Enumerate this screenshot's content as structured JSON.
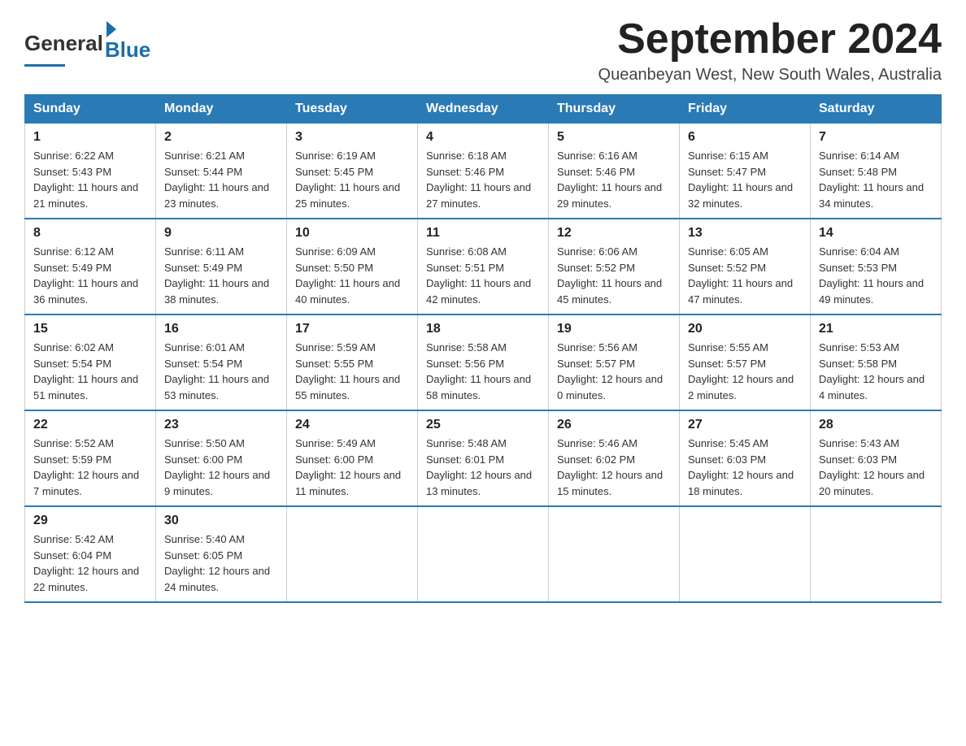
{
  "header": {
    "logo_general": "General",
    "logo_blue": "Blue",
    "month_title": "September 2024",
    "location": "Queanbeyan West, New South Wales, Australia"
  },
  "weekdays": [
    "Sunday",
    "Monday",
    "Tuesday",
    "Wednesday",
    "Thursday",
    "Friday",
    "Saturday"
  ],
  "weeks": [
    [
      {
        "day": "1",
        "sunrise": "6:22 AM",
        "sunset": "5:43 PM",
        "daylight": "11 hours and 21 minutes."
      },
      {
        "day": "2",
        "sunrise": "6:21 AM",
        "sunset": "5:44 PM",
        "daylight": "11 hours and 23 minutes."
      },
      {
        "day": "3",
        "sunrise": "6:19 AM",
        "sunset": "5:45 PM",
        "daylight": "11 hours and 25 minutes."
      },
      {
        "day": "4",
        "sunrise": "6:18 AM",
        "sunset": "5:46 PM",
        "daylight": "11 hours and 27 minutes."
      },
      {
        "day": "5",
        "sunrise": "6:16 AM",
        "sunset": "5:46 PM",
        "daylight": "11 hours and 29 minutes."
      },
      {
        "day": "6",
        "sunrise": "6:15 AM",
        "sunset": "5:47 PM",
        "daylight": "11 hours and 32 minutes."
      },
      {
        "day": "7",
        "sunrise": "6:14 AM",
        "sunset": "5:48 PM",
        "daylight": "11 hours and 34 minutes."
      }
    ],
    [
      {
        "day": "8",
        "sunrise": "6:12 AM",
        "sunset": "5:49 PM",
        "daylight": "11 hours and 36 minutes."
      },
      {
        "day": "9",
        "sunrise": "6:11 AM",
        "sunset": "5:49 PM",
        "daylight": "11 hours and 38 minutes."
      },
      {
        "day": "10",
        "sunrise": "6:09 AM",
        "sunset": "5:50 PM",
        "daylight": "11 hours and 40 minutes."
      },
      {
        "day": "11",
        "sunrise": "6:08 AM",
        "sunset": "5:51 PM",
        "daylight": "11 hours and 42 minutes."
      },
      {
        "day": "12",
        "sunrise": "6:06 AM",
        "sunset": "5:52 PM",
        "daylight": "11 hours and 45 minutes."
      },
      {
        "day": "13",
        "sunrise": "6:05 AM",
        "sunset": "5:52 PM",
        "daylight": "11 hours and 47 minutes."
      },
      {
        "day": "14",
        "sunrise": "6:04 AM",
        "sunset": "5:53 PM",
        "daylight": "11 hours and 49 minutes."
      }
    ],
    [
      {
        "day": "15",
        "sunrise": "6:02 AM",
        "sunset": "5:54 PM",
        "daylight": "11 hours and 51 minutes."
      },
      {
        "day": "16",
        "sunrise": "6:01 AM",
        "sunset": "5:54 PM",
        "daylight": "11 hours and 53 minutes."
      },
      {
        "day": "17",
        "sunrise": "5:59 AM",
        "sunset": "5:55 PM",
        "daylight": "11 hours and 55 minutes."
      },
      {
        "day": "18",
        "sunrise": "5:58 AM",
        "sunset": "5:56 PM",
        "daylight": "11 hours and 58 minutes."
      },
      {
        "day": "19",
        "sunrise": "5:56 AM",
        "sunset": "5:57 PM",
        "daylight": "12 hours and 0 minutes."
      },
      {
        "day": "20",
        "sunrise": "5:55 AM",
        "sunset": "5:57 PM",
        "daylight": "12 hours and 2 minutes."
      },
      {
        "day": "21",
        "sunrise": "5:53 AM",
        "sunset": "5:58 PM",
        "daylight": "12 hours and 4 minutes."
      }
    ],
    [
      {
        "day": "22",
        "sunrise": "5:52 AM",
        "sunset": "5:59 PM",
        "daylight": "12 hours and 7 minutes."
      },
      {
        "day": "23",
        "sunrise": "5:50 AM",
        "sunset": "6:00 PM",
        "daylight": "12 hours and 9 minutes."
      },
      {
        "day": "24",
        "sunrise": "5:49 AM",
        "sunset": "6:00 PM",
        "daylight": "12 hours and 11 minutes."
      },
      {
        "day": "25",
        "sunrise": "5:48 AM",
        "sunset": "6:01 PM",
        "daylight": "12 hours and 13 minutes."
      },
      {
        "day": "26",
        "sunrise": "5:46 AM",
        "sunset": "6:02 PM",
        "daylight": "12 hours and 15 minutes."
      },
      {
        "day": "27",
        "sunrise": "5:45 AM",
        "sunset": "6:03 PM",
        "daylight": "12 hours and 18 minutes."
      },
      {
        "day": "28",
        "sunrise": "5:43 AM",
        "sunset": "6:03 PM",
        "daylight": "12 hours and 20 minutes."
      }
    ],
    [
      {
        "day": "29",
        "sunrise": "5:42 AM",
        "sunset": "6:04 PM",
        "daylight": "12 hours and 22 minutes."
      },
      {
        "day": "30",
        "sunrise": "5:40 AM",
        "sunset": "6:05 PM",
        "daylight": "12 hours and 24 minutes."
      },
      null,
      null,
      null,
      null,
      null
    ]
  ]
}
